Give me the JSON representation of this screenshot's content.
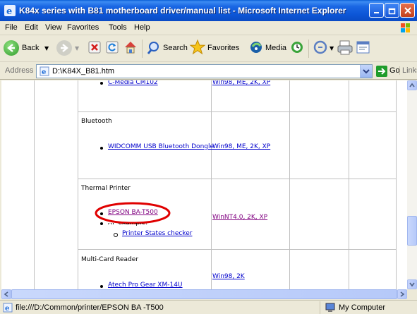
{
  "window": {
    "title": "K84x series with B81 motherboard driver/manual list - Microsoft Internet Explorer"
  },
  "menu": [
    "File",
    "Edit",
    "View",
    "Favorites",
    "Tools",
    "Help"
  ],
  "toolbar": {
    "back_label": "Back",
    "search_label": "Search",
    "favorites_label": "Favorites",
    "media_label": "Media"
  },
  "address": {
    "label": "Address",
    "value": "D:\\K84X_B81.htm",
    "go_label": "Go",
    "links_label": "Links"
  },
  "content": {
    "rows": [
      {
        "driver": "C-Media CM102",
        "os": "Win98, ME, 2K, XP"
      },
      {
        "section": "Bluetooth",
        "driver": "WIDCOMM USB Bluetooth Dongle",
        "os": "Win98, ME, 2K, XP"
      },
      {
        "section": "Thermal Printer",
        "driver": "EPSON BA-T500",
        "ap_label": "AP example:",
        "sub_item": "Printer States checker",
        "os": "WinNT4.0, 2K, XP"
      },
      {
        "section": "Multi-Card Reader",
        "driver": "Atech Pro Gear XM-14U",
        "os": "Win98, 2K"
      }
    ]
  },
  "status": {
    "text": "file:///D:/Common/printer/EPSON BA -T500",
    "zone": "My Computer"
  },
  "colors": {
    "link": "#0000cc",
    "visited_link": "#800080",
    "highlight_ellipse": "#e00000",
    "titlebar": "#0a55d6"
  }
}
